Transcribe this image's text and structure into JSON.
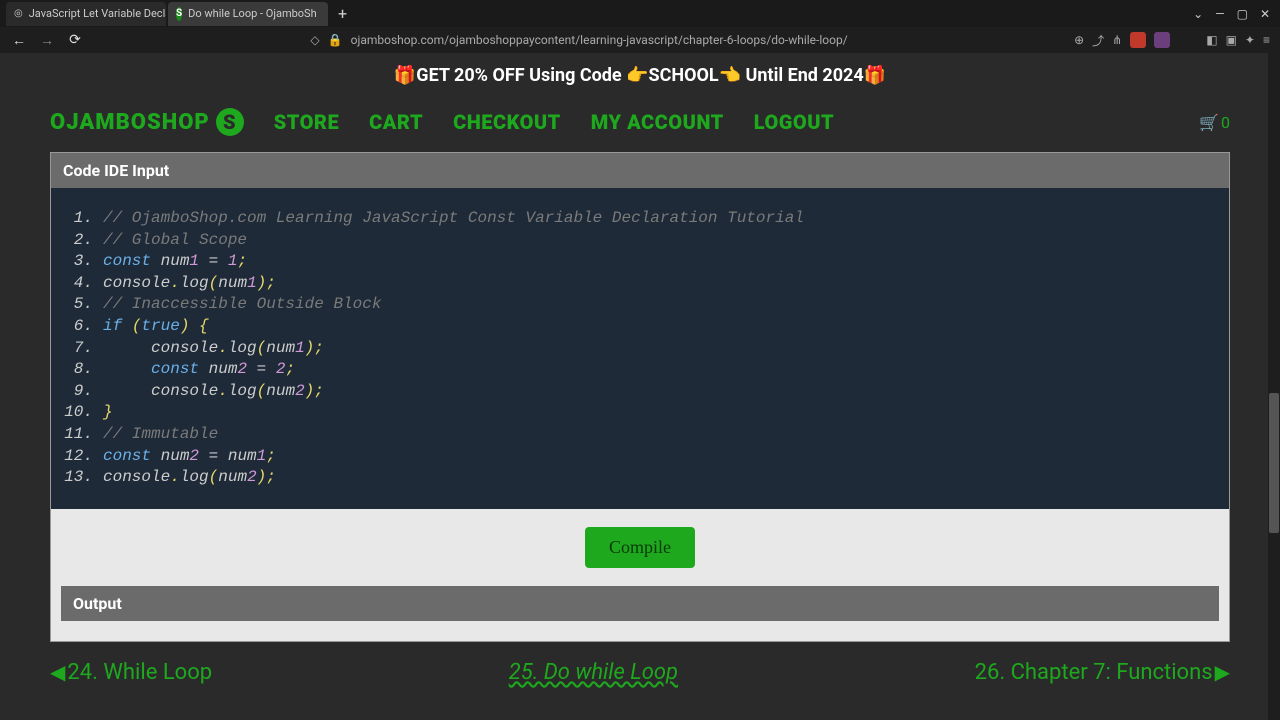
{
  "browser": {
    "tabs": [
      {
        "title": "JavaScript Let Variable Declara",
        "active": false,
        "favicon": "spiral"
      },
      {
        "title": "Do while Loop - OjamboSh",
        "active": true,
        "favicon": "S"
      }
    ],
    "url": "ojamboshop.com/ojamboshoppaycontent/learning-javascript/chapter-6-loops/do-while-loop/",
    "window_controls": {
      "down": "⌄",
      "min": "—",
      "max": "▢",
      "close": "✕"
    }
  },
  "promo": "🎁GET 20% OFF Using Code 👉SCHOOL👈 Until End 2024🎁",
  "nav": {
    "logo_text": "OJAMBOSHOP",
    "logo_s": "S",
    "links": [
      "STORE",
      "CART",
      "CHECKOUT",
      "MY ACCOUNT",
      "LOGOUT"
    ],
    "cart_count": "0"
  },
  "ide": {
    "header": "Code IDE Input",
    "compile": "Compile",
    "output_header": "Output",
    "code": [
      {
        "n": "1.",
        "tokens": [
          {
            "t": "comment",
            "v": "// OjamboShop.com Learning JavaScript Const Variable Declaration Tutorial"
          }
        ]
      },
      {
        "n": "2.",
        "tokens": [
          {
            "t": "comment",
            "v": "// Global Scope"
          }
        ]
      },
      {
        "n": "3.",
        "tokens": [
          {
            "t": "keyword",
            "v": "const "
          },
          {
            "t": "ident",
            "v": "num"
          },
          {
            "t": "num",
            "v": "1"
          },
          {
            "t": "ident",
            "v": " = "
          },
          {
            "t": "num",
            "v": "1"
          },
          {
            "t": "punct",
            "v": ";"
          }
        ]
      },
      {
        "n": "4.",
        "tokens": [
          {
            "t": "ident",
            "v": "console"
          },
          {
            "t": "punct",
            "v": "."
          },
          {
            "t": "method",
            "v": "log"
          },
          {
            "t": "punct",
            "v": "("
          },
          {
            "t": "ident",
            "v": "num"
          },
          {
            "t": "num",
            "v": "1"
          },
          {
            "t": "punct",
            "v": ")"
          },
          {
            "t": "punct",
            "v": ";"
          }
        ]
      },
      {
        "n": "5.",
        "tokens": [
          {
            "t": "comment",
            "v": "// Inaccessible Outside Block"
          }
        ]
      },
      {
        "n": "6.",
        "tokens": [
          {
            "t": "keyword",
            "v": "if "
          },
          {
            "t": "punct",
            "v": "("
          },
          {
            "t": "keyword",
            "v": "true"
          },
          {
            "t": "punct",
            "v": ")"
          },
          {
            "t": "ident",
            "v": " "
          },
          {
            "t": "brace",
            "v": "{"
          }
        ]
      },
      {
        "n": "7.",
        "tokens": [
          {
            "t": "ident",
            "v": "     console"
          },
          {
            "t": "punct",
            "v": "."
          },
          {
            "t": "method",
            "v": "log"
          },
          {
            "t": "punct",
            "v": "("
          },
          {
            "t": "ident",
            "v": "num"
          },
          {
            "t": "num",
            "v": "1"
          },
          {
            "t": "punct",
            "v": ")"
          },
          {
            "t": "punct",
            "v": ";"
          }
        ]
      },
      {
        "n": "8.",
        "tokens": [
          {
            "t": "ident",
            "v": "     "
          },
          {
            "t": "keyword",
            "v": "const "
          },
          {
            "t": "ident",
            "v": "num"
          },
          {
            "t": "num",
            "v": "2"
          },
          {
            "t": "ident",
            "v": " = "
          },
          {
            "t": "num",
            "v": "2"
          },
          {
            "t": "punct",
            "v": ";"
          }
        ]
      },
      {
        "n": "9.",
        "tokens": [
          {
            "t": "ident",
            "v": "     console"
          },
          {
            "t": "punct",
            "v": "."
          },
          {
            "t": "method",
            "v": "log"
          },
          {
            "t": "punct",
            "v": "("
          },
          {
            "t": "ident",
            "v": "num"
          },
          {
            "t": "num",
            "v": "2"
          },
          {
            "t": "punct",
            "v": ")"
          },
          {
            "t": "punct",
            "v": ";"
          }
        ]
      },
      {
        "n": "10.",
        "tokens": [
          {
            "t": "brace",
            "v": "}"
          }
        ]
      },
      {
        "n": "11.",
        "tokens": [
          {
            "t": "comment",
            "v": "// Immutable"
          }
        ]
      },
      {
        "n": "12.",
        "tokens": [
          {
            "t": "keyword",
            "v": "const "
          },
          {
            "t": "ident",
            "v": "num"
          },
          {
            "t": "num",
            "v": "2"
          },
          {
            "t": "ident",
            "v": " = num"
          },
          {
            "t": "num",
            "v": "1"
          },
          {
            "t": "punct",
            "v": ";"
          }
        ]
      },
      {
        "n": "13.",
        "tokens": [
          {
            "t": "ident",
            "v": "console"
          },
          {
            "t": "punct",
            "v": "."
          },
          {
            "t": "method",
            "v": "log"
          },
          {
            "t": "punct",
            "v": "("
          },
          {
            "t": "ident",
            "v": "num"
          },
          {
            "t": "num",
            "v": "2"
          },
          {
            "t": "punct",
            "v": ")"
          },
          {
            "t": "punct",
            "v": ";"
          }
        ]
      }
    ]
  },
  "footer": {
    "prev": "24. While Loop",
    "current": "25. Do while Loop",
    "next": "26. Chapter 7: Functions"
  }
}
